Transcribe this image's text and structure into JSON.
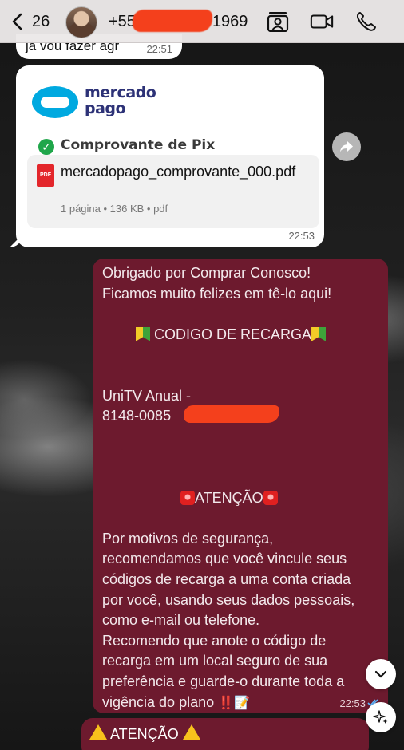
{
  "header": {
    "back_count": "26",
    "contact_name": "+55",
    "contact_suffix": "1969"
  },
  "messages": {
    "prev_text": "já vou fazer agr",
    "prev_time": "22:51",
    "attachment": {
      "brand_line1": "mercado",
      "brand_line2": "pago",
      "preview_title": "Comprovante de Pix",
      "file_icon": "PDF",
      "file_name": "mercadopago_comprovante_000.pdf",
      "file_meta": "1 página • 136 KB • pdf",
      "time": "22:53"
    },
    "outgoing": {
      "lines": [
        "Obrigado por Comprar Conosco!",
        "Ficamos muito felizes em tê-lo aqui!",
        "",
        " CODIGO DE RECARGA",
        "",
        "",
        "  UniTV Anual -",
        "8148-0085",
        "",
        "",
        "",
        "ATENÇÃO",
        "",
        "Por motivos de segurança,",
        "recomendamos que você vincule seus",
        "códigos de recarga a uma conta criada",
        "por você, usando seus dados pessoais,",
        "como e-mail ou telefone.",
        "Recomendo que anote o código de",
        "recarga em um local seguro de sua",
        "preferência e guarde-o durante toda a",
        "vigência do plano"
      ],
      "last_emojis": "‼️📝",
      "time": "22:53"
    },
    "next_bubble_text": "ATENÇÃO"
  },
  "icons": [
    "back-chevron-icon",
    "contact-card-icon",
    "video-call-icon",
    "phone-icon",
    "share-icon",
    "chevron-down-icon",
    "sparkle-icon"
  ]
}
